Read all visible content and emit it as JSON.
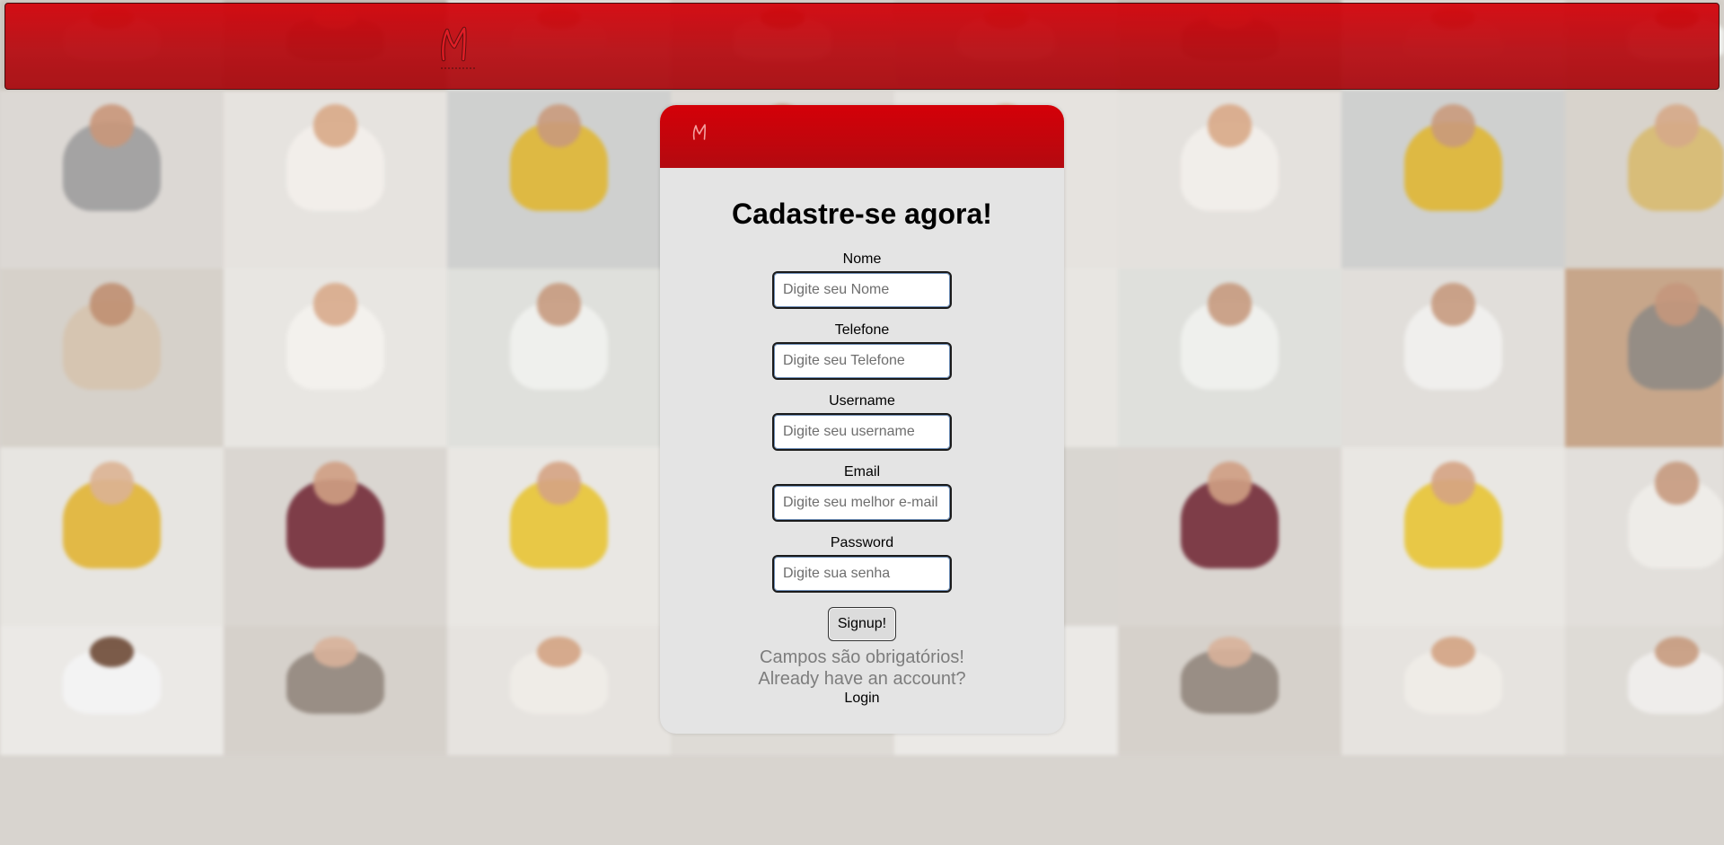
{
  "page": {
    "brand_color": "#c4070d",
    "card_background": "#e4e4e4"
  },
  "header": {
    "logo_icon": "brand-m-logo-icon"
  },
  "card": {
    "logo_icon": "brand-m-logo-icon",
    "title": "Cadastre-se agora!",
    "fields": [
      {
        "label": "Nome",
        "placeholder": "Digite seu Nome",
        "value": ""
      },
      {
        "label": "Telefone",
        "placeholder": "Digite seu Telefone",
        "value": ""
      },
      {
        "label": "Username",
        "placeholder": "Digite seu username",
        "value": ""
      },
      {
        "label": "Email",
        "placeholder": "Digite seu melhor e-mail",
        "value": ""
      },
      {
        "label": "Password",
        "placeholder": "Digite sua senha",
        "value": ""
      }
    ],
    "signup_label": "Signup!",
    "required_note": "Campos são obrigatórios!",
    "account_prompt": "Already have an account?",
    "login_label": "Login"
  }
}
